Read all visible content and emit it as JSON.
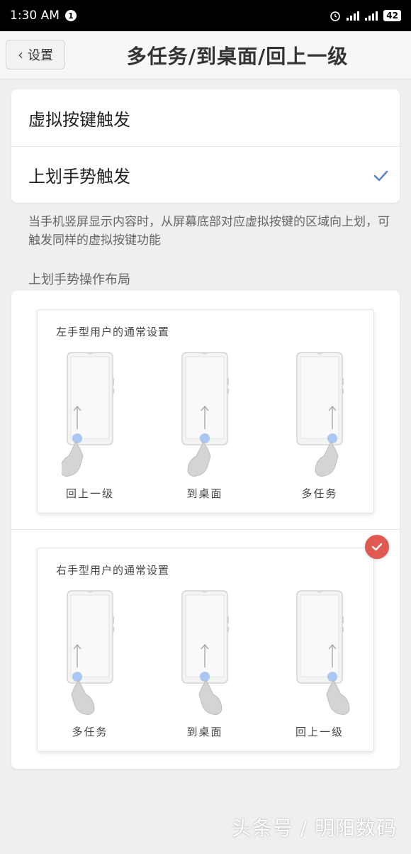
{
  "statusbar": {
    "time": "1:30 AM",
    "notification_count": "1",
    "battery": "42"
  },
  "header": {
    "back_label": "设置",
    "title": "多任务/到桌面/回上一级"
  },
  "options": [
    {
      "label": "虚拟按键触发",
      "selected": false
    },
    {
      "label": "上划手势触发",
      "selected": true
    }
  ],
  "description": "当手机竖屏显示内容时，从屏幕底部对应虚拟按键的区域向上划，可触发同样的虚拟按键功能",
  "layout_section_label": "上划手势操作布局",
  "layouts": [
    {
      "title": "左手型用户的通常设置",
      "labels": [
        "回上一级",
        "到桌面",
        "多任务"
      ],
      "selected": false
    },
    {
      "title": "右手型用户的通常设置",
      "labels": [
        "多任务",
        "到桌面",
        "回上一级"
      ],
      "selected": true
    }
  ],
  "colors": {
    "accent": "#5b86c9",
    "badge": "#e05a52",
    "dot": "#a9c7f2"
  },
  "watermark": "头条号 / 明阳数码"
}
